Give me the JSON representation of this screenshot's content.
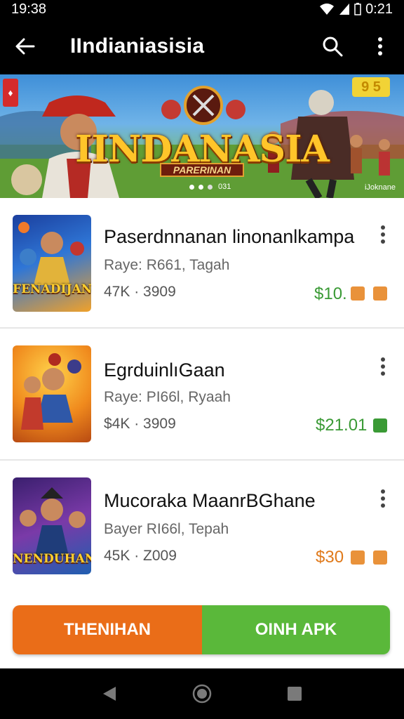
{
  "status_bar": {
    "time": "19:38",
    "battery_time": "0:21"
  },
  "app_bar": {
    "title": "IIndianiasisia"
  },
  "banner": {
    "title": "IINDANASIA",
    "subtitle": "PARERINAN",
    "counter": "031",
    "tag": "iJoknane",
    "badge_left": "",
    "badge_right": "9 5"
  },
  "items": [
    {
      "title": "Paserdnnanan linonanlkampa",
      "subtitle": "Raye: R661, Tagah",
      "meta": "47K · 3909",
      "price": "$10.",
      "price_color": "orange-accent",
      "thumb_label": "FENADIJAN"
    },
    {
      "title": "EgrduinlıGaan",
      "subtitle": "Raye: PI66l, Ryaah",
      "meta": "$4K · 3909",
      "price": "$21.01",
      "price_color": "green",
      "thumb_label": ""
    },
    {
      "title": "Mucoraka MaanrBGhane",
      "subtitle": "Bayer RI66l, Tepah",
      "meta": "45K · Z009",
      "price": "$30",
      "price_color": "orange",
      "thumb_label": "NENDUHAN"
    }
  ],
  "cta": {
    "left_label": "THENIHAN",
    "right_label": "OINH APK"
  },
  "colors": {
    "orange": "#ea6d18",
    "green": "#5ab83a",
    "price_green": "#3a9a35",
    "price_orange": "#e07a1b"
  }
}
